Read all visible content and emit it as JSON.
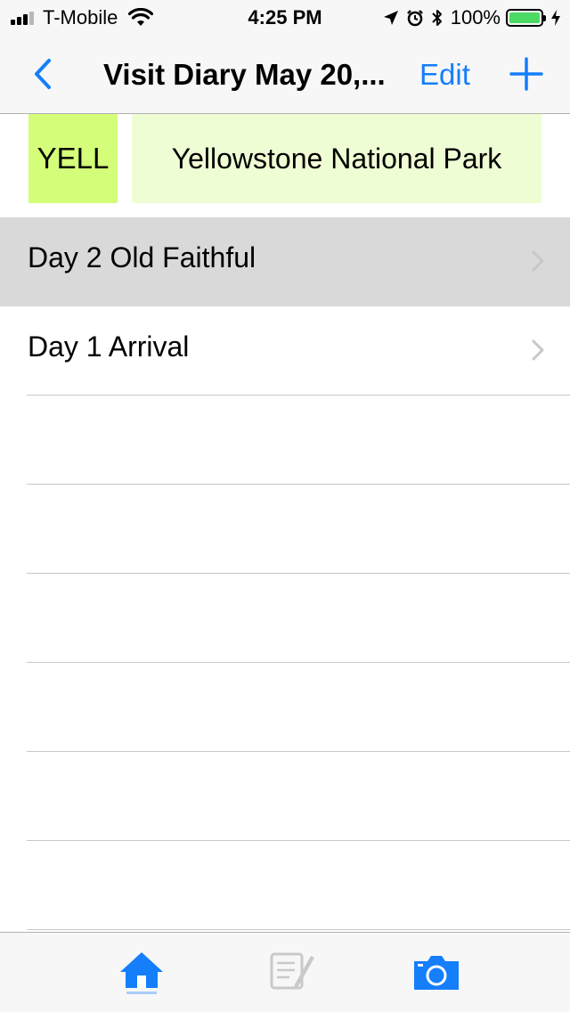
{
  "status_bar": {
    "carrier": "T-Mobile",
    "time": "4:25 PM",
    "battery": "100%",
    "battery_level": 1.0
  },
  "nav": {
    "back_icon": "chevron-left-icon",
    "title": "Visit Diary May 20,...",
    "edit_label": "Edit",
    "add_icon": "plus-icon"
  },
  "park": {
    "code": "YELL",
    "name": "Yellowstone National Park"
  },
  "entries": [
    {
      "label": "Day 2 Old Faithful",
      "selected": true
    },
    {
      "label": "Day 1 Arrival",
      "selected": false
    }
  ],
  "tabs": [
    {
      "icon": "home-icon",
      "active": true
    },
    {
      "icon": "notebook-icon",
      "active": false
    },
    {
      "icon": "camera-icon",
      "active": false
    }
  ],
  "colors": {
    "accent": "#157efb",
    "park_code_bg": "#d4fd79",
    "park_name_bg": "#effdd4",
    "selected_row": "#d9d9d9",
    "battery_fill": "#4cd964"
  }
}
